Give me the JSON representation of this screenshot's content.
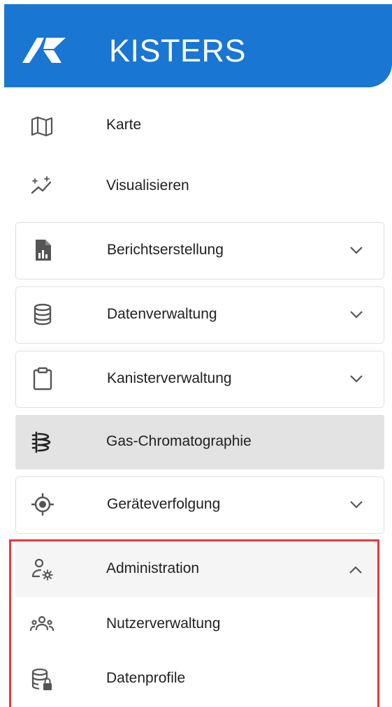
{
  "header": {
    "brand": "KISTERS"
  },
  "nav": {
    "items": [
      {
        "label": "Karte",
        "icon": "map-icon"
      },
      {
        "label": "Visualisieren",
        "icon": "visualize-icon"
      },
      {
        "label": "Berichtserstellung",
        "icon": "report-icon",
        "expandable": true
      },
      {
        "label": "Datenverwaltung",
        "icon": "database-icon",
        "expandable": true
      },
      {
        "label": "Kanisterverwaltung",
        "icon": "clipboard-icon",
        "expandable": true
      },
      {
        "label": "Gas-Chromatographie",
        "icon": "chromatography-icon",
        "active": true
      },
      {
        "label": "Geräteverfolgung",
        "icon": "target-icon",
        "expandable": true
      }
    ],
    "admin": {
      "label": "Administration",
      "icon": "user-settings-icon",
      "expanded": true,
      "children": [
        {
          "label": "Nutzerverwaltung",
          "icon": "user-group-icon"
        },
        {
          "label": "Datenprofile",
          "icon": "database-lock-icon"
        }
      ]
    }
  },
  "colors": {
    "brand": "#1976d2",
    "highlight": "#e53b3e",
    "active_bg": "#e3e3e3"
  }
}
